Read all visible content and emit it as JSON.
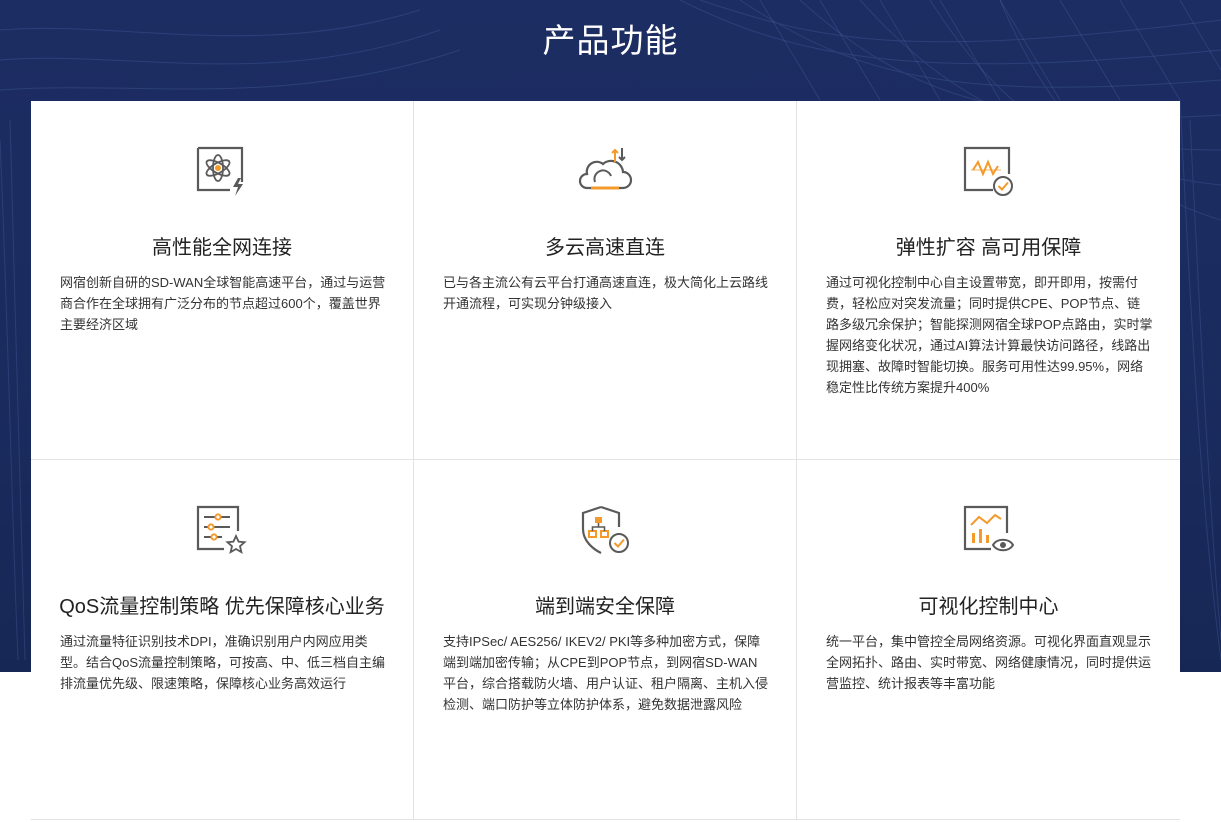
{
  "section": {
    "title": "产品功能"
  },
  "colors": {
    "accent": "#f39a2b",
    "icon_stroke": "#5a5a5a",
    "hero_bg": "#1b2b60"
  },
  "features": [
    {
      "icon": "atom-lightning-icon",
      "title": "高性能全网连接",
      "desc": "网宿创新自研的SD-WAN全球智能高速平台，通过与运营商合作在全球拥有广泛分布的节点超过600个，覆盖世界主要经济区域"
    },
    {
      "icon": "cloud-transfer-icon",
      "title": "多云高速直连",
      "desc": "已与各主流公有云平台打通高速直连，极大简化上云路线开通流程，可实现分钟级接入"
    },
    {
      "icon": "waveform-check-icon",
      "title": "弹性扩容 高可用保障",
      "desc": "通过可视化控制中心自主设置带宽，即开即用，按需付费，轻松应对突发流量；同时提供CPE、POP节点、链路多级冗余保护；智能探测网宿全球POP点路由，实时掌握网络变化状况，通过AI算法计算最快访问路径，线路出现拥塞、故障时智能切换。服务可用性达99.95%，网络稳定性比传统方案提升400%"
    },
    {
      "icon": "settings-list-star-icon",
      "title": "QoS流量控制策略 优先保障核心业务",
      "desc": "通过流量特征识别技术DPI，准确识别用户内网应用类型。结合QoS流量控制策略，可按高、中、低三档自主编排流量优先级、限速策略，保障核心业务高效运行"
    },
    {
      "icon": "shield-network-check-icon",
      "title": "端到端安全保障",
      "desc": "支持IPSec/ AES256/ IKEV2/ PKI等多种加密方式，保障端到端加密传输；从CPE到POP节点，到网宿SD-WAN平台，综合搭载防火墙、用户认证、租户隔离、主机入侵检测、端口防护等立体防护体系，避免数据泄露风险"
    },
    {
      "icon": "chart-eye-icon",
      "title": "可视化控制中心",
      "desc": "统一平台，集中管控全局网络资源。可视化界面直观显示全网拓扑、路由、实时带宽、网络健康情况，同时提供运营监控、统计报表等丰富功能"
    }
  ]
}
